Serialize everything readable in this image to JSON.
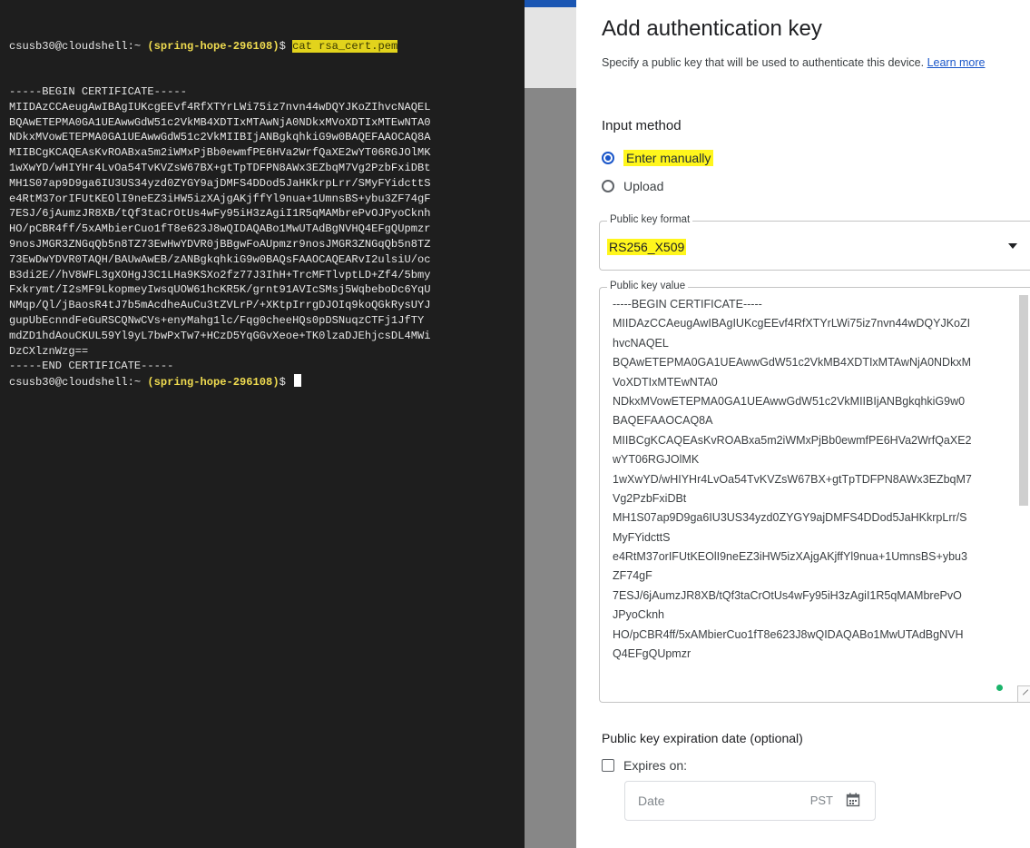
{
  "terminal": {
    "prompt_user": "csusb30@cloudshell:~",
    "prompt_project": "(spring-hope-296108)",
    "prompt_symbol": "$",
    "command": "cat rsa_cert.pem",
    "output": [
      "-----BEGIN CERTIFICATE-----",
      "MIIDAzCCAeugAwIBAgIUKcgEEvf4RfXTYrLWi75iz7nvn44wDQYJKoZIhvcNAQEL",
      "BQAwETEPMA0GA1UEAwwGdW51c2VkMB4XDTIxMTAwNjA0NDkxMVoXDTIxMTEwNTA0",
      "NDkxMVowETEPMA0GA1UEAwwGdW51c2VkMIIBIjANBgkqhkiG9w0BAQEFAAOCAQ8A",
      "MIIBCgKCAQEAsKvROABxa5m2iWMxPjBb0ewmfPE6HVa2WrfQaXE2wYT06RGJOlMK",
      "1wXwYD/wHIYHr4LvOa54TvKVZsW67BX+gtTpTDFPN8AWx3EZbqM7Vg2PzbFxiDBt",
      "MH1S07ap9D9ga6IU3US34yzd0ZYGY9ajDMFS4DDod5JaHKkrpLrr/SMyFYidcttS",
      "e4RtM37orIFUtKEOlI9neEZ3iHW5izXAjgAKjffYl9nua+1UmnsBS+ybu3ZF74gF",
      "7ESJ/6jAumzJR8XB/tQf3taCrOtUs4wFy95iH3zAgiI1R5qMAMbrePvOJPyoCknh",
      "HO/pCBR4ff/5xAMbierCuo1fT8e623J8wQIDAQABo1MwUTAdBgNVHQ4EFgQUpmzr",
      "9nosJMGR3ZNGqQb5n8TZ73EwHwYDVR0jBBgwFoAUpmzr9nosJMGR3ZNGqQb5n8TZ",
      "73EwDwYDVR0TAQH/BAUwAwEB/zANBgkqhkiG9w0BAQsFAAOCAQEARvI2ulsiU/oc",
      "B3di2E//hV8WFL3gXOHgJ3C1LHa9KSXo2fz77J3IhH+TrcMFTlvptLD+Zf4/5bmy",
      "Fxkrymt/I2sMF9LkopmeyIwsqUOW61hcKR5K/grnt91AVIcSMsj5WqbeboDc6YqU",
      "NMqp/Ql/jBaosR4tJ7b5mAcdheAuCu3tZVLrP/+XKtpIrrgDJOIq9koQGkRysUYJ",
      "gupUbEcnndFeGuRSCQNwCVs+enyMahg1lc/Fqg0cheeHQs0pDSNuqzCTFj1JfTY",
      "mdZD1hdAouCKUL59Yl9yL7bwPxTw7+HCzD5YqGGvXeoe+TK0lzaDJEhjcsDL4MWi",
      "DzCXlznWzg==",
      "-----END CERTIFICATE-----"
    ]
  },
  "panel": {
    "title": "Add authentication key",
    "subtitle": "Specify a public key that will be used to authenticate this device.",
    "learn_more": "Learn more",
    "input_method_label": "Input method",
    "option_manual": "Enter manually",
    "option_upload": "Upload",
    "format_legend": "Public key format",
    "format_value": "RS256_X509",
    "value_legend": "Public key value",
    "value_lines": [
      "-----BEGIN CERTIFICATE-----",
      "MIIDAzCCAeugAwIBAgIUKcgEEvf4RfXTYrLWi75iz7nvn44wDQYJKoZI",
      "hvcNAQEL",
      "BQAwETEPMA0GA1UEAwwGdW51c2VkMB4XDTIxMTAwNjA0NDkxM",
      "VoXDTIxMTEwNTA0",
      "NDkxMVowETEPMA0GA1UEAwwGdW51c2VkMIIBIjANBgkqhkiG9w0",
      "BAQEFAAOCAQ8A",
      "MIIBCgKCAQEAsKvROABxa5m2iWMxPjBb0ewmfPE6HVa2WrfQaXE2",
      "wYT06RGJOlMK",
      "1wXwYD/wHIYHr4LvOa54TvKVZsW67BX+gtTpTDFPN8AWx3EZbqM7",
      "Vg2PzbFxiDBt",
      "MH1S07ap9D9ga6IU3US34yzd0ZYGY9ajDMFS4DDod5JaHKkrpLrr/S",
      "MyFYidcttS",
      "e4RtM37orIFUtKEOlI9neEZ3iHW5izXAjgAKjffYl9nua+1UmnsBS+ybu3",
      "ZF74gF",
      "7ESJ/6jAumzJR8XB/tQf3taCrOtUs4wFy95iH3zAgiI1R5qMAMbrePvO",
      "JPyoCknh",
      "HO/pCBR4ff/5xAMbierCuo1fT8e623J8wQIDAQABo1MwUTAdBgNVH",
      "Q4EFgQUpmzr"
    ],
    "expiration_label": "Public key expiration date (optional)",
    "expires_on": "Expires on:",
    "date_placeholder": "Date",
    "timezone": "PST"
  },
  "colors": {
    "terminal_bg": "#1e1e1e",
    "project_yellow": "#f0dc50",
    "highlight_yellow": "#fff61c",
    "accent_blue": "#1a56c9"
  },
  "icons": {
    "caret": "chevron-down-icon",
    "calendar": "calendar-icon"
  }
}
